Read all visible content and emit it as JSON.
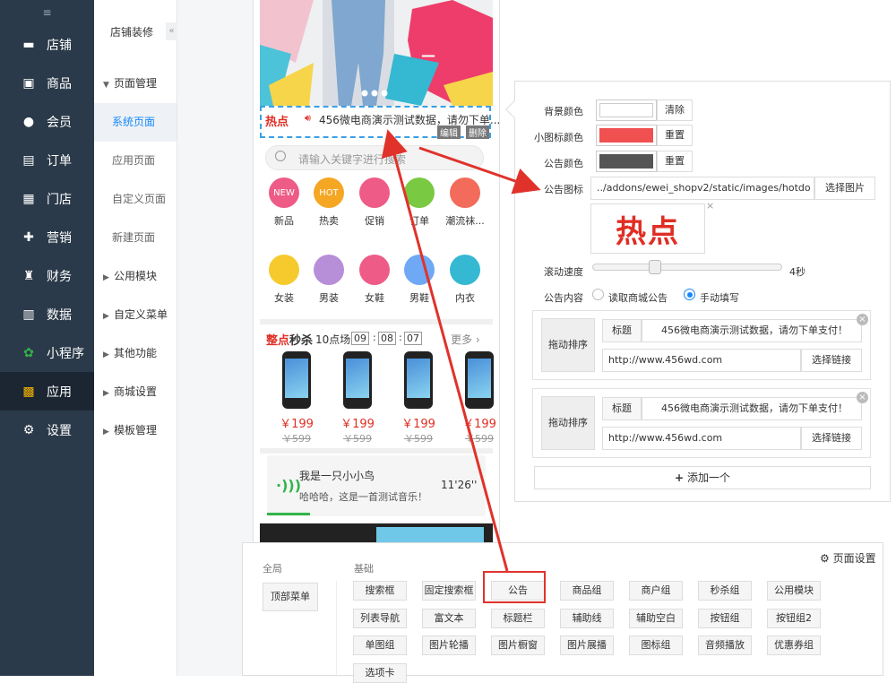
{
  "colors": {
    "nav_bg": "#2b3a4a",
    "accent": "#1989fa",
    "notice_border": "#3b9fe3",
    "price_red": "#e02e24",
    "annotation_red": "#e0322b"
  },
  "leftnav": {
    "collapse_glyph": "≡",
    "items": [
      {
        "label": "店铺",
        "icon": "store-icon"
      },
      {
        "label": "商品",
        "icon": "goods-icon"
      },
      {
        "label": "会员",
        "icon": "member-icon"
      },
      {
        "label": "订单",
        "icon": "order-icon"
      },
      {
        "label": "门店",
        "icon": "shop-icon"
      },
      {
        "label": "营销",
        "icon": "gift-icon"
      },
      {
        "label": "财务",
        "icon": "finance-icon"
      },
      {
        "label": "数据",
        "icon": "chart-icon"
      },
      {
        "label": "小程序",
        "icon": "miniprogram-icon"
      },
      {
        "label": "应用",
        "icon": "apps-icon",
        "active": true
      },
      {
        "label": "设置",
        "icon": "gear-icon"
      }
    ]
  },
  "subnav": {
    "title": "店铺装修",
    "collapse": "«",
    "sections": [
      {
        "label": "页面管理",
        "expanded": true,
        "items": [
          "系统页面",
          "应用页面",
          "自定义页面",
          "新建页面"
        ]
      },
      {
        "label": "公用模块"
      },
      {
        "label": "自定义菜单"
      },
      {
        "label": "其他功能"
      },
      {
        "label": "商城设置"
      },
      {
        "label": "模板管理"
      }
    ]
  },
  "phone": {
    "banner_minus": "—",
    "notice": {
      "badge1": "热点",
      "text": "456微电商演示测试数据，请勿下单...",
      "edit": "编辑",
      "delete": "删除"
    },
    "search": {
      "placeholder": "请输入关键字进行搜索"
    },
    "cats_row1": [
      "新品",
      "热卖",
      "促销",
      "订单",
      "潮流袜..."
    ],
    "cats_row1_badges": [
      "NEW",
      "HOT",
      "",
      "",
      ""
    ],
    "cats_row2": [
      "女装",
      "男装",
      "女鞋",
      "男鞋",
      "内衣"
    ],
    "seckill": {
      "brand1": "整点",
      "brand2": "秒杀",
      "time": "10点场",
      "h": "09",
      "m": "08",
      "s": "07",
      "more": "更多 ›"
    },
    "products": [
      {
        "price": "￥199",
        "orig": "￥599"
      },
      {
        "price": "￥199",
        "orig": "￥599"
      },
      {
        "price": "￥199",
        "orig": "￥599"
      },
      {
        "price": "￥199",
        "orig": "￥599"
      }
    ],
    "music": {
      "title": "我是一只小小鸟",
      "subtitle": "哈哈哈，这是一首测试音乐！",
      "duration": "11'26''"
    }
  },
  "settings": {
    "bg_color_label": "背景颜色",
    "clear": "清除",
    "icon_color_label": "小图标颜色",
    "icon_color": "#f05050",
    "reset1": "重置",
    "notice_color_label": "公告颜色",
    "notice_color": "#555555",
    "reset2": "重置",
    "icon_label": "公告图标",
    "icon_path": "../addons/ewei_shopv2/static/images/hotdo",
    "choose_image": "选择图片",
    "icon_preview": "热点",
    "speed_label": "滚动速度",
    "speed_value": "4秒",
    "speed_fraction": 0.33,
    "content_label": "公告内容",
    "radio1": "读取商城公告",
    "radio2": "手动填写",
    "items": [
      {
        "drag": "拖动排序",
        "title_label": "标题",
        "title": "456微电商演示测试数据，请勿下单支付！",
        "link": "http://www.456wd.com",
        "choose_link": "选择链接"
      },
      {
        "drag": "拖动排序",
        "title_label": "标题",
        "title": "456微电商演示测试数据，请勿下单支付！",
        "link": "http://www.456wd.com",
        "choose_link": "选择链接"
      }
    ],
    "add_one": "添加一个"
  },
  "components": {
    "page_settings": "页面设置",
    "global_label": "全局",
    "global_btn": "顶部菜单",
    "basic_label": "基础",
    "row1": [
      "搜索框",
      "固定搜索框",
      "公告",
      "商品组",
      "商户组",
      "秒杀组",
      "公用模块"
    ],
    "row2": [
      "列表导航",
      "富文本",
      "标题栏",
      "辅助线",
      "辅助空白",
      "按钮组",
      "按钮组2"
    ],
    "row3": [
      "单图组",
      "图片轮播",
      "图片橱窗",
      "图片展播",
      "图标组",
      "音频播放",
      "优惠券组"
    ],
    "row4": [
      "选项卡"
    ]
  }
}
